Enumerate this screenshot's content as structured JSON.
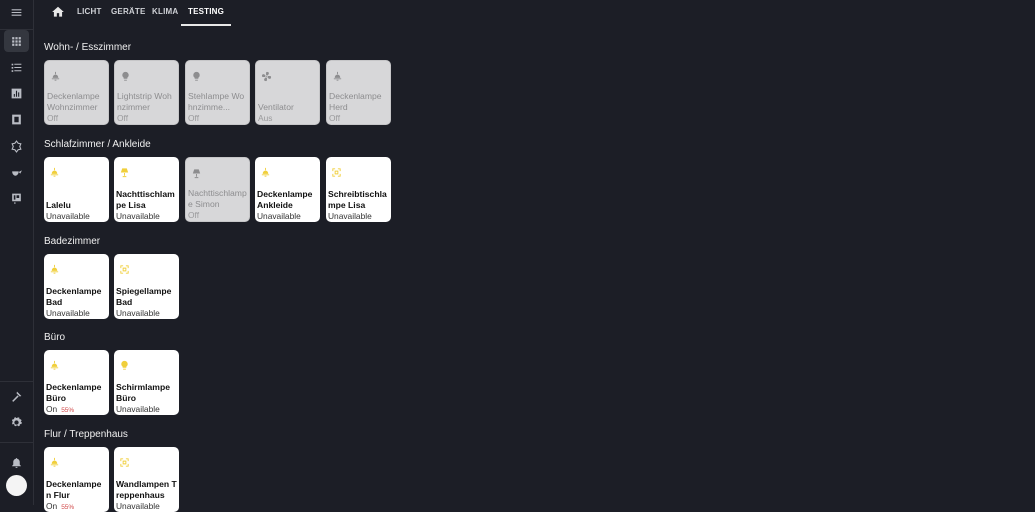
{
  "sidebar": {
    "icons": [
      "menu-icon",
      "dashboard-grid-icon",
      "list-icon",
      "chart-icon",
      "cube-icon",
      "puzzle-icon",
      "teapot-icon",
      "calendar-icon",
      "hammer-icon",
      "gear-icon",
      "bell-icon"
    ]
  },
  "tabs": [
    "LICHT",
    "GERÄTE",
    "KLIMA",
    "TESTING"
  ],
  "active_tab": "TESTING",
  "sections": [
    {
      "title": "Wohn- / Esszimmer",
      "cards": [
        {
          "name": "Deckenlampe Wohnzimmer",
          "state": "Off",
          "icon": "ceiling-light-icon",
          "active": false
        },
        {
          "name": "Lightstrip Wohnzimmer",
          "state": "Off",
          "icon": "bulb-icon",
          "active": false
        },
        {
          "name": "Stehlampe Wohnzimme...",
          "state": "Off",
          "icon": "bulb-icon",
          "active": false
        },
        {
          "name": "Ventilator",
          "state": "Aus",
          "icon": "fan-icon",
          "active": false
        },
        {
          "name": "Deckenlampe Herd",
          "state": "Off",
          "icon": "ceiling-light-icon",
          "active": false
        }
      ]
    },
    {
      "title": "Schlafzimmer / Ankleide",
      "cards": [
        {
          "name": "Lalelu",
          "state": "Unavailable",
          "icon": "ceiling-light-icon",
          "active": true
        },
        {
          "name": "Nachttischlampe Lisa",
          "state": "Unavailable",
          "icon": "lamp-icon",
          "active": true
        },
        {
          "name": "Nachttischlampe Simon",
          "state": "Off",
          "icon": "lamp-icon",
          "active": false
        },
        {
          "name": "Deckenlampe Ankleide",
          "state": "Unavailable",
          "icon": "ceiling-light-icon",
          "active": true
        },
        {
          "name": "Schreibtischlampe Lisa",
          "state": "Unavailable",
          "icon": "spotlight-icon",
          "active": true
        }
      ]
    },
    {
      "title": "Badezimmer",
      "cards": [
        {
          "name": "Deckenlampe Bad",
          "state": "Unavailable",
          "icon": "ceiling-light-icon",
          "active": true
        },
        {
          "name": "Spiegellampe Bad",
          "state": "Unavailable",
          "icon": "spotlight-icon",
          "active": true
        }
      ]
    },
    {
      "title": "Büro",
      "cards": [
        {
          "name": "Deckenlampe Büro",
          "state": "On",
          "brightness": "55%",
          "icon": "ceiling-light-icon",
          "active": true
        },
        {
          "name": "Schirmlampe Büro",
          "state": "Unavailable",
          "icon": "bulb-icon",
          "active": true
        }
      ]
    },
    {
      "title": "Flur / Treppenhaus",
      "cards": [
        {
          "name": "Deckenlampe n Flur",
          "state": "On",
          "brightness": "55%",
          "icon": "ceiling-light-icon",
          "active": true
        },
        {
          "name": "Wandlampen Treppenhaus",
          "state": "Unavailable",
          "icon": "spotlight-icon",
          "active": true
        }
      ]
    }
  ],
  "colors": {
    "background": "#1c1e26",
    "icon_on": "#f0cf3b",
    "icon_off": "#8d8d8f",
    "card_off": "#d7d7d9"
  }
}
